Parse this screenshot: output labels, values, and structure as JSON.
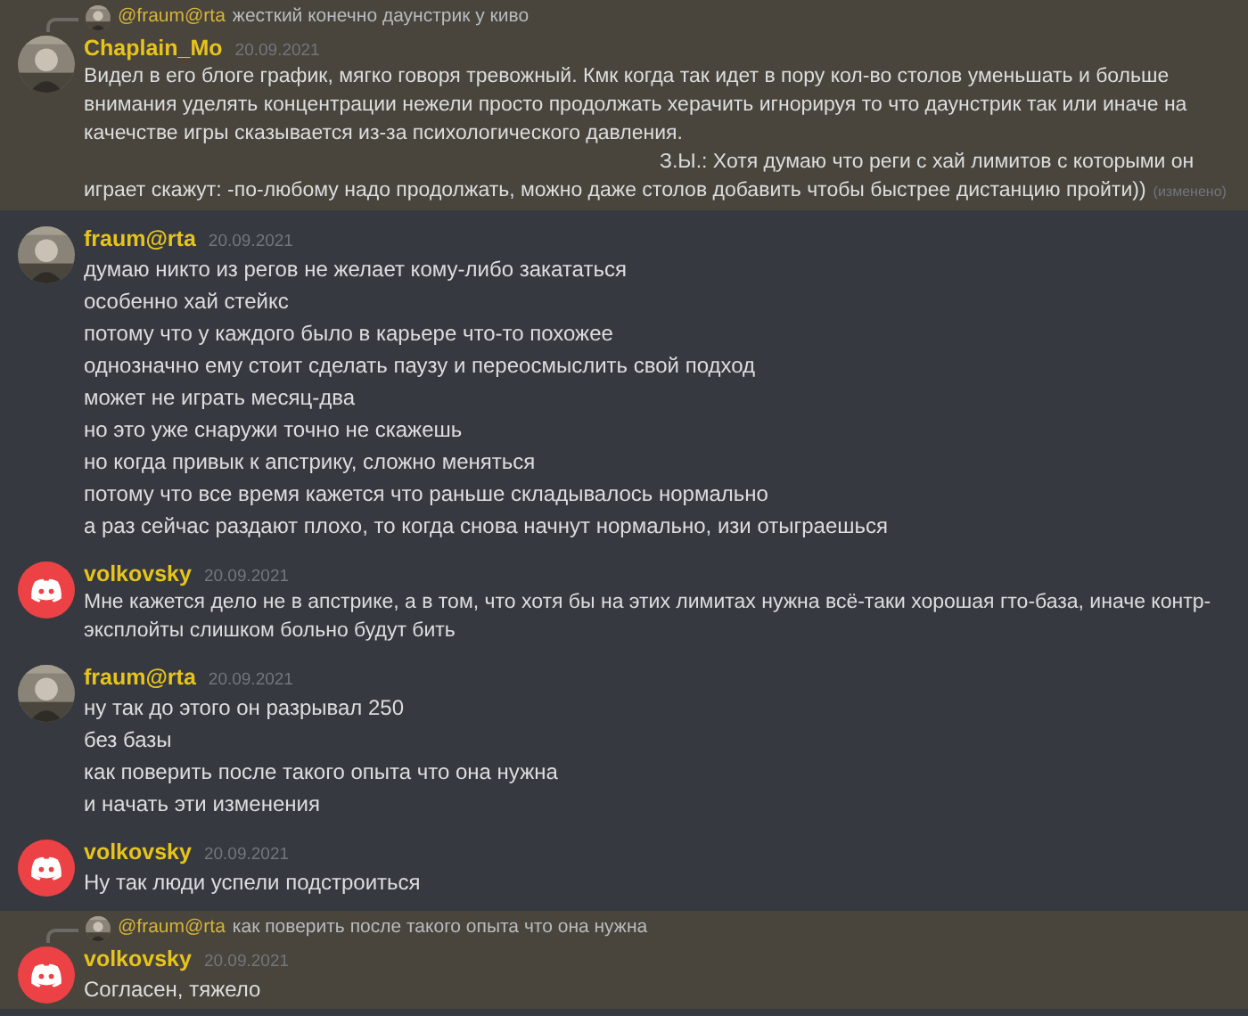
{
  "messages": [
    {
      "highlighted": true,
      "reply": {
        "mention": "@fraum@rta",
        "text": "жесткий конечно даунстрик у киво"
      },
      "author": "Chaplain_Mo",
      "date": "20.09.2021",
      "paragraphs": [
        {
          "kind": "plain",
          "text": "Видел в его блоге график, мягко говоря тревожный.  Кмк когда так идет в пору кол-во столов уменьшать и больше внимания уделять концентрации нежели просто продолжать херачить игнорируя то что даунстрик так или иначе на качечстве игры сказывается из-за психологического давления."
        },
        {
          "kind": "indented",
          "text": "З.Ы.: Хотя думаю что реги с хай лимитов с которыми он играет скажут: -по-любому надо продолжать, можно даже столов добавить чтобы быстрее дистанцию пройти))"
        }
      ],
      "edited": "(изменено)"
    },
    {
      "highlighted": false,
      "author": "fraum@rta",
      "date": "20.09.2021",
      "paragraphs": [
        {
          "kind": "line",
          "text": "думаю никто из регов не желает кому-либо закататься"
        },
        {
          "kind": "line",
          "text": "особенно хай стейкс"
        },
        {
          "kind": "line",
          "text": "потому что у каждого было в карьере что-то похожее"
        },
        {
          "kind": "line",
          "text": "однозначно ему стоит сделать паузу и переосмыслить свой подход"
        },
        {
          "kind": "line",
          "text": "может не играть месяц-два"
        },
        {
          "kind": "line",
          "text": "но это уже снаружи точно не скажешь"
        },
        {
          "kind": "line",
          "text": "но когда привык к апстрику, сложно меняться"
        },
        {
          "kind": "line",
          "text": "потому что все время кажется что раньше складывалось нормально"
        },
        {
          "kind": "line",
          "text": "а раз сейчас раздают плохо, то когда снова начнут нормально, изи отыграешься"
        }
      ]
    },
    {
      "highlighted": false,
      "avatar": {
        "kind": "discord"
      },
      "author": "volkovsky",
      "date": "20.09.2021",
      "paragraphs": [
        {
          "kind": "plain",
          "text": "Мне кажется дело не в апстрике, а в том, что хотя бы на этих лимитах нужна всё-таки хорошая гто-база, иначе контр-эксплойты слишком больно будут бить"
        }
      ]
    },
    {
      "highlighted": false,
      "author": "fraum@rta",
      "date": "20.09.2021",
      "paragraphs": [
        {
          "kind": "line",
          "text": "ну так до этого он разрывал 250"
        },
        {
          "kind": "line",
          "text": "без базы"
        },
        {
          "kind": "line",
          "text": "как поверить после такого опыта что она нужна"
        },
        {
          "kind": "line",
          "text": "и начать эти изменения"
        }
      ]
    },
    {
      "highlighted": false,
      "avatar": {
        "kind": "discord"
      },
      "author": "volkovsky",
      "date": "20.09.2021",
      "paragraphs": [
        {
          "kind": "line",
          "text": "Ну так люди успели подстроиться"
        }
      ]
    },
    {
      "highlighted": true,
      "reply": {
        "mention": "@fraum@rta",
        "text": "как поверить после такого опыта что она нужна"
      },
      "avatar": {
        "kind": "discord"
      },
      "author": "volkovsky",
      "date": "20.09.2021",
      "paragraphs": [
        {
          "kind": "line",
          "text": "Согласен, тяжело"
        }
      ]
    }
  ]
}
